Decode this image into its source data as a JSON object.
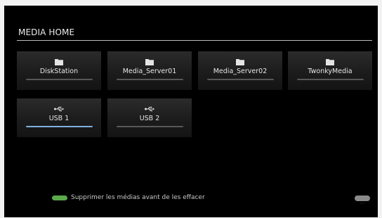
{
  "header": {
    "title": "MEDIA HOME"
  },
  "tiles": [
    {
      "label": "DiskStation",
      "icon": "folder-icon",
      "selected": false
    },
    {
      "label": "Media_Server01",
      "icon": "folder-icon",
      "selected": false
    },
    {
      "label": "Media_Server02",
      "icon": "folder-icon",
      "selected": false
    },
    {
      "label": "TwonkyMedia",
      "icon": "folder-icon",
      "selected": false
    },
    {
      "label": "USB 1",
      "icon": "usb-icon",
      "selected": true
    },
    {
      "label": "USB 2",
      "icon": "usb-icon",
      "selected": false
    }
  ],
  "footer": {
    "hint_text": "Supprimer les médias avant de les effacer",
    "hint_key": "green-button-icon",
    "back_key": "back-button-icon"
  },
  "colors": {
    "background": "#000000",
    "selected_bar": "#7fb0e0",
    "green_key": "#5aaa4a"
  }
}
